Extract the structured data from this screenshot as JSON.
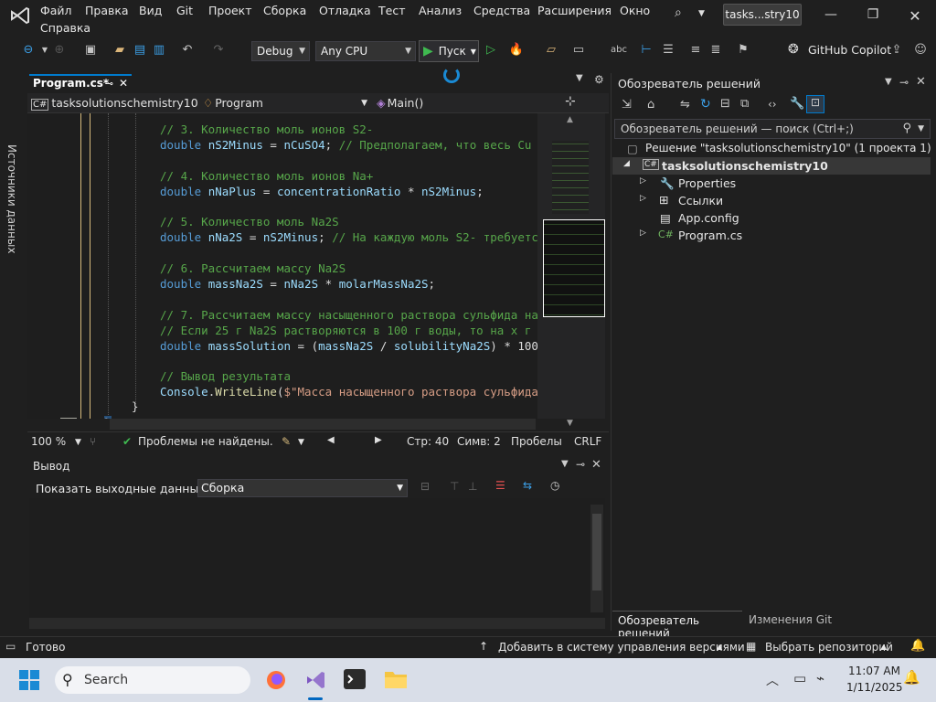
{
  "menu": [
    "Файл",
    "Правка",
    "Вид",
    "Git",
    "Проект",
    "Сборка",
    "Отладка",
    "Тест",
    "Анализ",
    "Средства",
    "Расширения",
    "Окно",
    "Справка"
  ],
  "window_title": "tasks...stry10",
  "toolbar": {
    "config": "Debug",
    "platform": "Any CPU",
    "run_label": "Пуск",
    "copilot": "GitHub Copilot"
  },
  "left_strip_label": "Источники данных",
  "editor": {
    "tab_label": "Program.cs*",
    "nav_project": "tasksolutionschemistry10",
    "nav_class": "Program",
    "nav_member": "Main()",
    "lines": [
      {
        "parts": [
          [
            "cm",
            "// 3. Количество моль ионов S2-"
          ]
        ]
      },
      {
        "parts": [
          [
            "kw",
            "double "
          ],
          [
            "id",
            "nS2Minus"
          ],
          [
            "pl",
            " = "
          ],
          [
            "id",
            "nCuSO4"
          ],
          [
            "pl",
            "; "
          ],
          [
            "cm",
            "// Предполагаем, что весь Cu"
          ]
        ]
      },
      {
        "parts": []
      },
      {
        "parts": [
          [
            "cm",
            "// 4. Количество моль ионов Na+"
          ]
        ]
      },
      {
        "parts": [
          [
            "kw",
            "double "
          ],
          [
            "id",
            "nNaPlus"
          ],
          [
            "pl",
            " = "
          ],
          [
            "id",
            "concentrationRatio"
          ],
          [
            "pl",
            " * "
          ],
          [
            "id",
            "nS2Minus"
          ],
          [
            "pl",
            ";"
          ]
        ]
      },
      {
        "parts": []
      },
      {
        "parts": [
          [
            "cm",
            "// 5. Количество моль Na2S"
          ]
        ]
      },
      {
        "parts": [
          [
            "kw",
            "double "
          ],
          [
            "id",
            "nNa2S"
          ],
          [
            "pl",
            " = "
          ],
          [
            "id",
            "nS2Minus"
          ],
          [
            "pl",
            "; "
          ],
          [
            "cm",
            "// На каждую моль S2- требуется"
          ]
        ]
      },
      {
        "parts": []
      },
      {
        "parts": [
          [
            "cm",
            "// 6. Рассчитаем массу Na2S"
          ]
        ]
      },
      {
        "parts": [
          [
            "kw",
            "double "
          ],
          [
            "id",
            "massNa2S"
          ],
          [
            "pl",
            " = "
          ],
          [
            "id",
            "nNa2S"
          ],
          [
            "pl",
            " * "
          ],
          [
            "id",
            "molarMassNa2S"
          ],
          [
            "pl",
            ";"
          ]
        ]
      },
      {
        "parts": []
      },
      {
        "parts": [
          [
            "cm",
            "// 7. Рассчитаем массу насыщенного раствора сульфида на"
          ]
        ]
      },
      {
        "parts": [
          [
            "cm",
            "// Если 25 г Na2S растворяются в 100 г воды, то на x г"
          ]
        ]
      },
      {
        "parts": [
          [
            "kw",
            "double "
          ],
          [
            "id",
            "massSolution"
          ],
          [
            "pl",
            " = ("
          ],
          [
            "id",
            "massNa2S"
          ],
          [
            "pl",
            " / "
          ],
          [
            "id",
            "solubilityNa2S"
          ],
          [
            "pl",
            ") * 100"
          ]
        ]
      },
      {
        "parts": []
      },
      {
        "parts": [
          [
            "cm",
            "// Вывод результата"
          ]
        ]
      },
      {
        "parts": [
          [
            "id",
            "Console"
          ],
          [
            "pl",
            "."
          ],
          [
            "fn",
            "WriteLine"
          ],
          [
            "pl",
            "("
          ],
          [
            "st",
            "$\"Масса насыщенного раствора сульфида"
          ]
        ]
      }
    ],
    "close_brace_inner": "}",
    "close_brace_outer": "}",
    "zoom": "100 %",
    "problems": "Проблемы не найдены.",
    "line": "Стр: 40",
    "col": "Симв: 2",
    "spaces": "Пробелы",
    "eol": "CRLF"
  },
  "output": {
    "title": "Вывод",
    "show_from_label": "Показать выходные данные из:",
    "source": "Сборка"
  },
  "solution_explorer": {
    "title": "Обозреватель решений",
    "search_placeholder": "Обозреватель решений — поиск (Ctrl+;)",
    "solution": "Решение \"tasksolutionschemistry10\"  (1 проекта 1)",
    "project": "tasksolutionschemistry10",
    "items": [
      "Properties",
      "Ссылки",
      "App.config",
      "Program.cs"
    ],
    "bottom_tabs": [
      "Обозреватель решений",
      "Изменения Git"
    ]
  },
  "statusbar": {
    "ready": "Готово",
    "add_vcs": "Добавить в систему управления версиями",
    "select_repo": "Выбрать репозиторий"
  },
  "taskbar": {
    "search": "Search",
    "time": "11:07 AM",
    "date": "1/11/2025"
  },
  "colors": {
    "accent": "#007acc",
    "comment": "#57a64a",
    "keyword": "#569cd6",
    "identifier": "#9cdcfe"
  }
}
